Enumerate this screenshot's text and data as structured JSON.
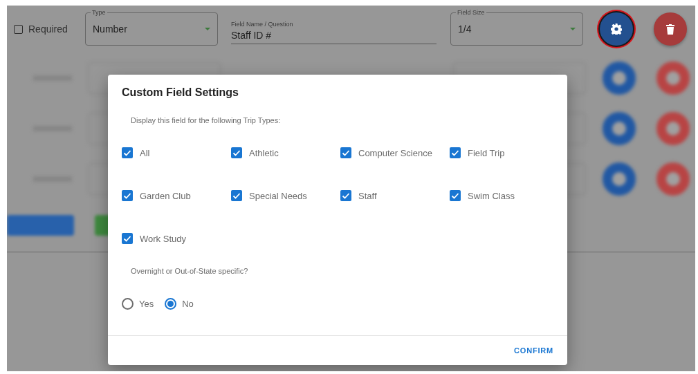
{
  "form_row": {
    "required": {
      "label": "Required",
      "checked": false
    },
    "type": {
      "label": "Type",
      "value": "Number"
    },
    "field_name": {
      "label": "Field Name / Question",
      "value": "Staff ID #"
    },
    "field_size": {
      "label": "Field Size",
      "value": "1/4"
    },
    "settings_highlighted": true
  },
  "dialog": {
    "title": "Custom Field Settings",
    "subtitle": "Display this field for the following Trip Types:",
    "trip_types": [
      {
        "label": "All",
        "checked": true
      },
      {
        "label": "Athletic",
        "checked": true
      },
      {
        "label": "Computer Science",
        "checked": true
      },
      {
        "label": "Field Trip",
        "checked": true
      },
      {
        "label": "Garden Club",
        "checked": true
      },
      {
        "label": "Special Needs",
        "checked": true
      },
      {
        "label": "Staff",
        "checked": true
      },
      {
        "label": "Swim Class",
        "checked": true
      },
      {
        "label": "Work Study",
        "checked": true
      }
    ],
    "question": "Overnight or Out-of-State specific?",
    "options": [
      {
        "label": "Yes",
        "selected": false
      },
      {
        "label": "No",
        "selected": true
      }
    ],
    "confirm": "CONFIRM"
  }
}
